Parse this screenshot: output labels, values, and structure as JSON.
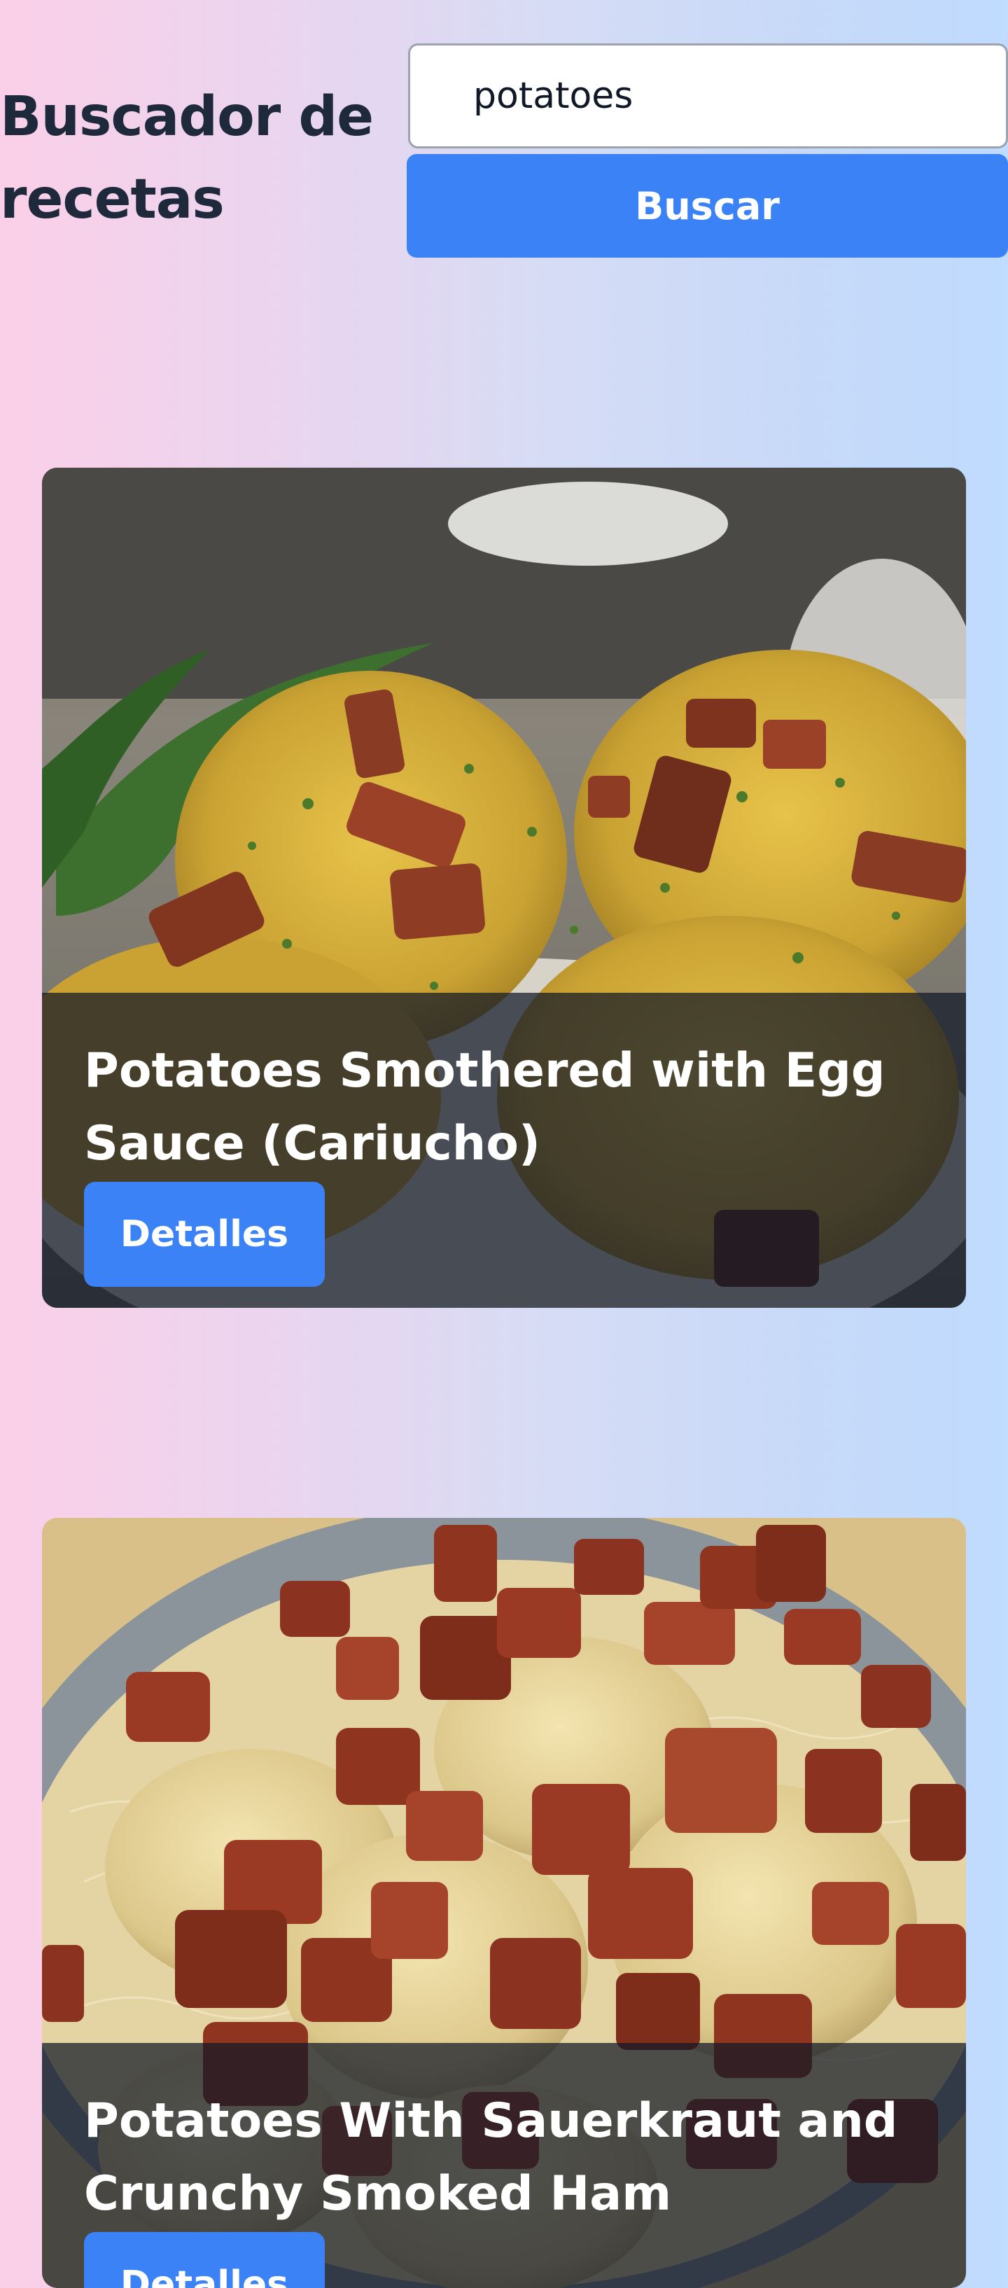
{
  "header": {
    "title": "Buscador de recetas",
    "search": {
      "value": "potatoes",
      "placeholder": ""
    },
    "search_button_label": "Buscar"
  },
  "recipes": [
    {
      "title": "Potatoes Smothered with Egg Sauce (Cariucho)",
      "details_label": "Detalles"
    },
    {
      "title": "Potatoes With Sauerkraut and Crunchy Smoked Ham",
      "details_label": "Detalles"
    }
  ],
  "colors": {
    "accent": "#3b82f6",
    "title_text": "#1e293b",
    "gradient_start": "#fbcfe8",
    "gradient_end": "#bfdbfe"
  }
}
